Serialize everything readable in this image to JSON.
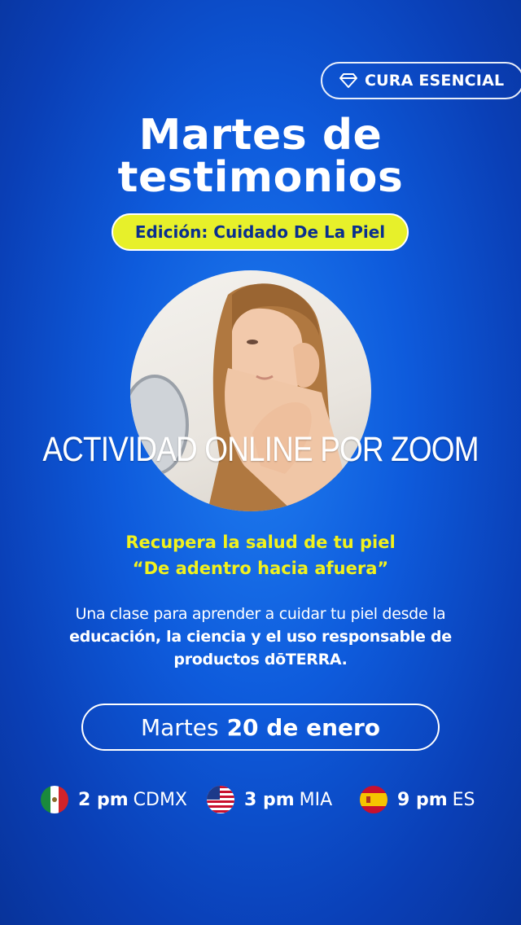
{
  "badge": {
    "label": "CURA ESENCIAL",
    "icon": "diamond-icon"
  },
  "title": {
    "line1": "Martes de",
    "line2": "testimonios"
  },
  "edition": "Edición: Cuidado De La Piel",
  "overlay_text": "ACTIVIDAD ONLINE POR ZOOM",
  "headline": {
    "line1": "Recupera la salud de tu piel",
    "line2": "“De adentro hacia afuera”"
  },
  "description": {
    "line1": "Una clase para aprender a cuidar tu piel desde la",
    "line2": "educación, la ciencia y el uso responsable de",
    "line3": "productos dōTERRA."
  },
  "date": {
    "day": "Martes",
    "date": "20 de enero"
  },
  "schedule": [
    {
      "flag": "mexico-flag-icon",
      "time": "2 pm",
      "zone": "CDMX"
    },
    {
      "flag": "usa-flag-icon",
      "time": "3 pm",
      "zone": "MIA"
    },
    {
      "flag": "spain-flag-icon",
      "time": "9 pm",
      "zone": "ES"
    }
  ],
  "colors": {
    "background": "#0e5bdc",
    "accent_yellow": "#e7f02a",
    "text_yellow": "#f2f21c",
    "edition_text": "#0a2f8e"
  }
}
